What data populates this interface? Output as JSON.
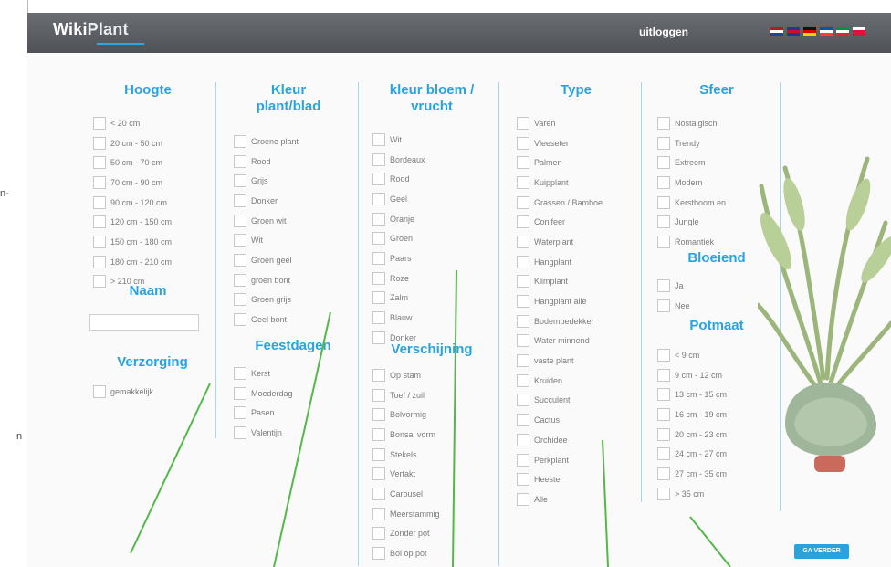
{
  "margin_fragments": [
    "n-",
    "n"
  ],
  "app": {
    "logo_left": "Wiki",
    "logo_right": "Plant",
    "logout": "uitloggen"
  },
  "flags": [
    {
      "name": "flag-nl-icon",
      "colors": [
        "#ae1c28",
        "#ffffff",
        "#21468b"
      ]
    },
    {
      "name": "flag-uk-icon",
      "colors": [
        "#1f3a8a",
        "#c8102e",
        "#1f3a8a"
      ]
    },
    {
      "name": "flag-de-icon",
      "colors": [
        "#111111",
        "#dd0000",
        "#ffce00"
      ]
    },
    {
      "name": "flag-fr-icon",
      "colors": [
        "#0055a4",
        "#ffffff",
        "#ef4135"
      ]
    },
    {
      "name": "flag-it-icon",
      "colors": [
        "#009246",
        "#ffffff",
        "#ce2b37"
      ]
    },
    {
      "name": "flag-pl-icon",
      "colors": [
        "#ffffff",
        "#dc143c",
        "#dc143c"
      ]
    }
  ],
  "filters": {
    "hoogte": {
      "title": "Hoogte",
      "options": [
        "< 20 cm",
        "20 cm - 50 cm",
        "50 cm - 70 cm",
        "70 cm - 90 cm",
        "90 cm - 120 cm",
        "120 cm - 150 cm",
        "150 cm - 180 cm",
        "180 cm - 210 cm",
        "> 210 cm"
      ]
    },
    "naam": {
      "title": "Naam",
      "value": ""
    },
    "verzorging": {
      "title": "Verzorging",
      "options": [
        "gemakkelijk"
      ]
    },
    "kleur_plant": {
      "title_line1": "Kleur",
      "title_line2": "plant/blad",
      "options": [
        "Groene plant",
        "Rood",
        "Grijs",
        "Donker",
        "Groen wit",
        "Wit",
        "Groen geel",
        "groen bont",
        "Groen grijs",
        "Geel bont"
      ]
    },
    "feestdagen": {
      "title": "Feestdagen",
      "options": [
        "Kerst",
        "Moederdag",
        "Pasen",
        "Valentijn"
      ]
    },
    "kleur_bloem": {
      "title_line1": "kleur bloem /",
      "title_line2": "vrucht",
      "options": [
        "Wit",
        "Bordeaux",
        "Rood",
        "Geel",
        "Oranje",
        "Groen",
        "Paars",
        "Roze",
        "Zalm",
        "Blauw",
        "Donker"
      ]
    },
    "verschijning": {
      "title": "Verschijning",
      "options": [
        "Op stam",
        "Toef / zuil",
        "Bolvormig",
        "Bonsai vorm",
        "Stekels",
        "Vertakt",
        "Carousel",
        "Meerstammig",
        "Zonder pot",
        "Bol op pot"
      ]
    },
    "type": {
      "title": "Type",
      "options": [
        "Varen",
        "Vleeseter",
        "Palmen",
        "Kuipplant",
        "Grassen / Bamboe",
        "Conifeer",
        "Waterplant",
        "Hangplant",
        "Klimplant",
        "Hangplant alle",
        "Bodembedekker",
        "Water minnend",
        "vaste plant",
        "Kruiden",
        "Succulent",
        "Cactus",
        "Orchidee",
        "Perkplant",
        "Heester",
        "Alle"
      ]
    },
    "sfeer": {
      "title": "Sfeer",
      "options": [
        "Nostalgisch",
        "Trendy",
        "Extreem",
        "Modern",
        "Kerstboom en",
        "Jungle",
        "Romantiek"
      ]
    },
    "bloeiend": {
      "title": "Bloeiend",
      "options": [
        "Ja",
        "Nee"
      ]
    },
    "potmaat": {
      "title": "Potmaat",
      "options": [
        "< 9 cm",
        "9 cm - 12 cm",
        "13 cm - 15 cm",
        "16 cm - 19 cm",
        "20 cm - 23 cm",
        "24 cm - 27 cm",
        "27 cm - 35 cm",
        "> 35 cm"
      ]
    }
  },
  "go_button": "GA VERDER",
  "colors": {
    "accent": "#2aa3dc",
    "topbar": "#55585d",
    "separator": "#9fd9f0",
    "annotation": "#54b848"
  }
}
